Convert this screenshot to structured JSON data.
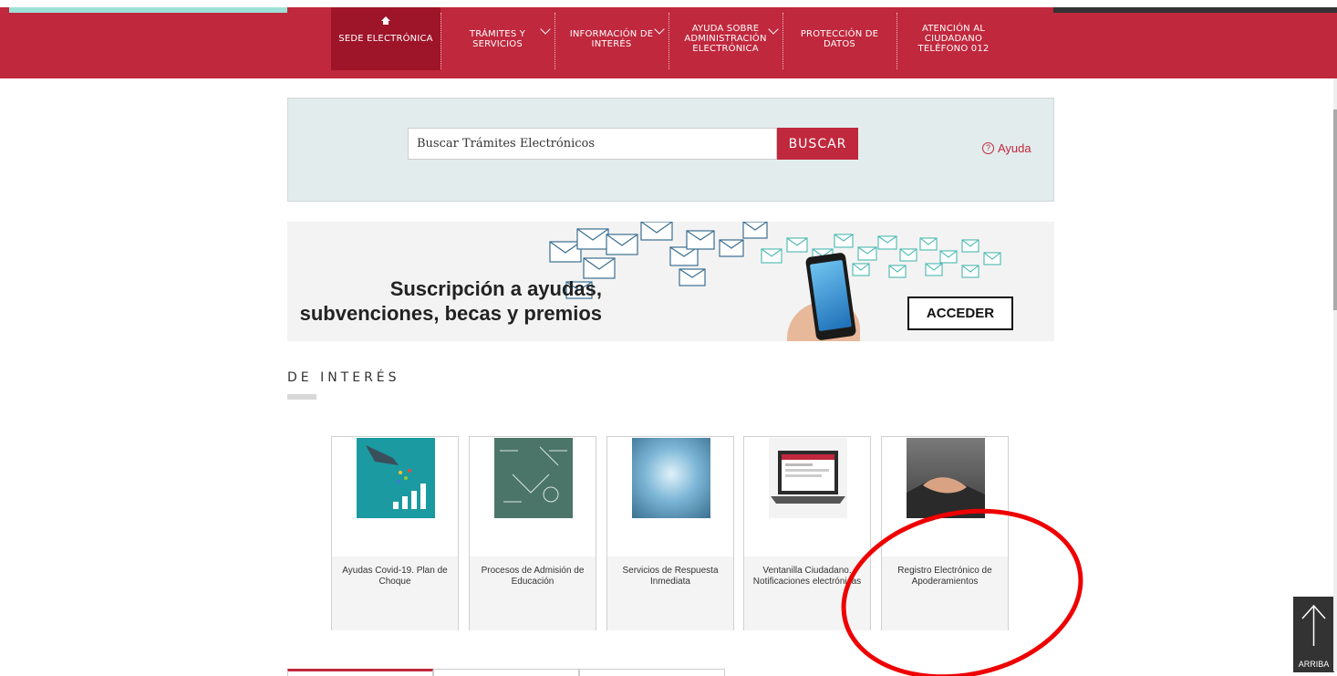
{
  "nav": {
    "items": [
      {
        "label": "SEDE ELECTRÓNICA"
      },
      {
        "label": "TRÁMITES Y\nSERVICIOS"
      },
      {
        "label": "INFORMACIÓN DE\nINTERÉS"
      },
      {
        "label": "AYUDA SOBRE\nADMINISTRACIÓN\nELECTRÓNICA"
      },
      {
        "label": "PROTECCIÓN DE\nDATOS"
      },
      {
        "label": "ATENCIÓN AL\nCIUDADANO\nTELÉFONO 012"
      }
    ]
  },
  "search": {
    "placeholder": "Buscar Trámites Electrónicos",
    "button_label": "BUSCAR",
    "help_label": "Ayuda",
    "help_icon_glyph": "?"
  },
  "banner": {
    "title": "Suscripción a ayudas,\nsubvenciones, becas y premios",
    "button_label": "ACCEDER"
  },
  "interes": {
    "title": "DE INTERÉS",
    "cards": [
      {
        "label": "Ayudas Covid-19. Plan de Choque"
      },
      {
        "label": "Procesos de Admisión de Educación"
      },
      {
        "label": "Servicios de Respuesta Inmediata"
      },
      {
        "label": "Ventanilla Ciudadano. Notificaciones electrónicas"
      },
      {
        "label": "Registro Electrónico de Apoderamientos"
      }
    ]
  },
  "back_to_top": {
    "label": "ARRIBA"
  },
  "colors": {
    "brand": "#c0283d",
    "annotation": "#ee0000"
  }
}
